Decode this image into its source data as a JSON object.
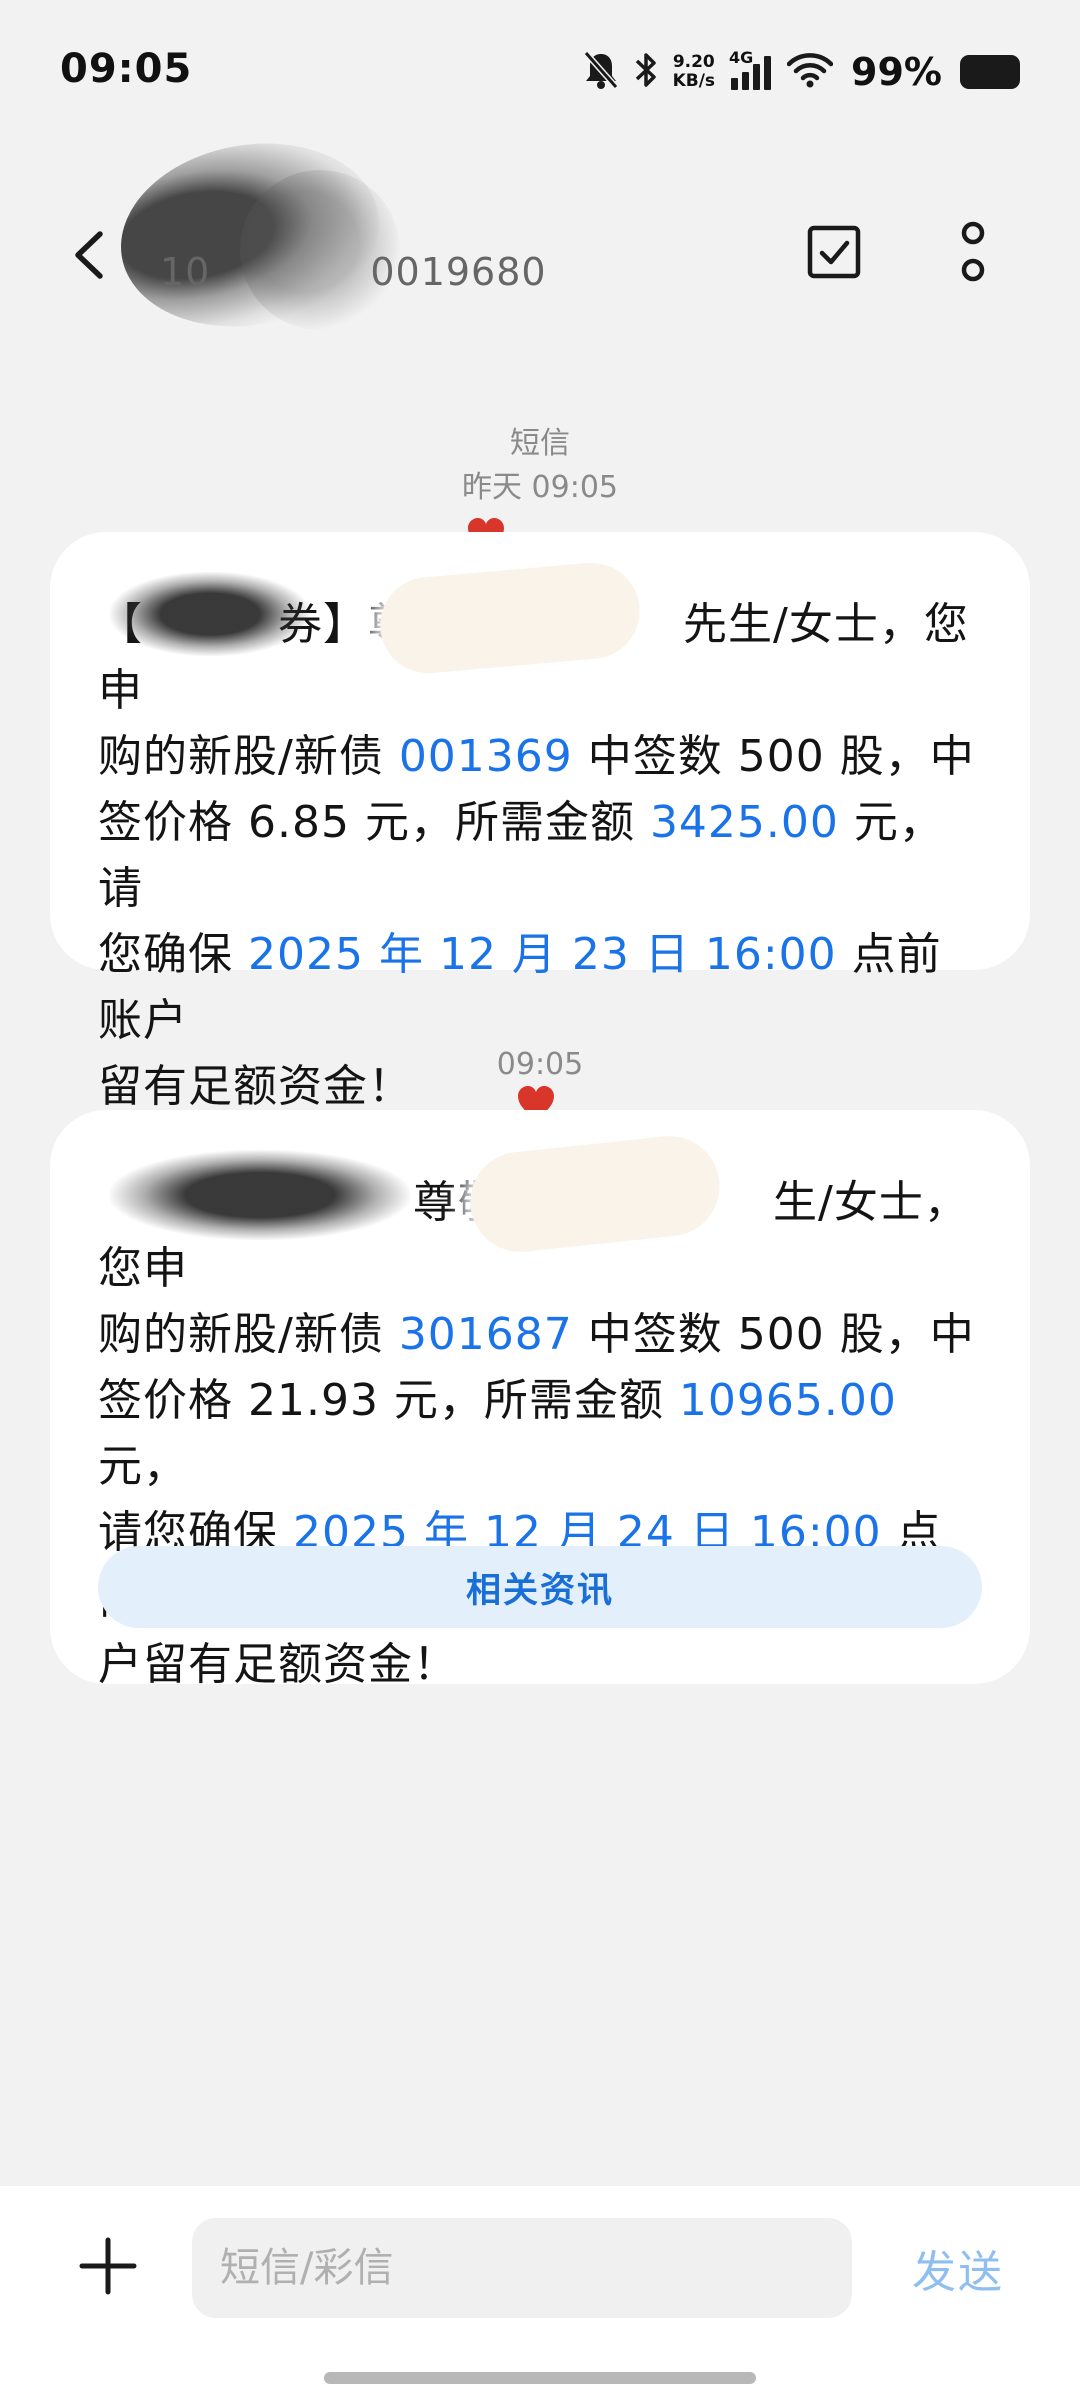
{
  "status_bar": {
    "time": "09:05",
    "net_speed_value": "9.20",
    "net_speed_unit": "KB/s",
    "network_type": "4G",
    "battery_percent": "99%",
    "icons": [
      "mute-icon",
      "bluetooth-icon",
      "signal-icon",
      "wifi-icon",
      "battery-icon"
    ]
  },
  "header": {
    "contact_number": "10        0019680",
    "back_icon": "chevron-left-icon",
    "select_icon": "checkbox-icon",
    "more_icon": "more-vertical-icon"
  },
  "messages": [
    {
      "timestamp_label": "短信",
      "timestamp": "昨天 09:05",
      "lines": [
        {
          "segments": [
            {
              "t": "【",
              "hl": false
            },
            {
              "t": "   券】尊",
              "hl": false
            },
            {
              "t": "      ",
              "hl": false
            },
            {
              "t": "先生/女士，您申",
              "hl": false
            }
          ]
        },
        {
          "segments": [
            {
              "t": "购的新股/新债 ",
              "hl": false
            },
            {
              "t": "001369",
              "hl": true
            },
            {
              "t": " 中签数 500 股，中",
              "hl": false
            }
          ]
        },
        {
          "segments": [
            {
              "t": "签价格 6.85 元，所需金额 ",
              "hl": false
            },
            {
              "t": "3425.00",
              "hl": true
            },
            {
              "t": " 元，请",
              "hl": false
            }
          ]
        },
        {
          "segments": [
            {
              "t": "您确保 ",
              "hl": false
            },
            {
              "t": "2025 年 12 月 23 日 16:00",
              "hl": true
            },
            {
              "t": " 点前账户",
              "hl": false
            }
          ]
        },
        {
          "segments": [
            {
              "t": "留有足额资金！",
              "hl": false
            }
          ]
        }
      ]
    },
    {
      "timestamp": "09:05",
      "lines": [
        {
          "segments": [
            {
              "t": "       尊敬",
              "hl": false
            },
            {
              "t": "      ",
              "hl": false
            },
            {
              "t": "生/女士，您申",
              "hl": false
            }
          ]
        },
        {
          "segments": [
            {
              "t": "购的新股/新债 ",
              "hl": false
            },
            {
              "t": "301687",
              "hl": true
            },
            {
              "t": " 中签数 500 股，中",
              "hl": false
            }
          ]
        },
        {
          "segments": [
            {
              "t": "签价格 21.93 元，所需金额 ",
              "hl": false
            },
            {
              "t": "10965.00",
              "hl": true
            },
            {
              "t": " 元，",
              "hl": false
            }
          ]
        },
        {
          "segments": [
            {
              "t": "请您确保 ",
              "hl": false
            },
            {
              "t": "2025 年 12 月 24 日 16:00",
              "hl": true
            },
            {
              "t": " 点前账",
              "hl": false
            }
          ]
        },
        {
          "segments": [
            {
              "t": "户留有足额资金！",
              "hl": false
            }
          ]
        }
      ],
      "action_button": "相关资讯"
    }
  ],
  "composer": {
    "placeholder": "短信/彩信",
    "send_label": "发送",
    "plus_icon": "plus-icon"
  },
  "colors": {
    "highlight": "#1a73e8",
    "send_disabled": "#8fbff0",
    "related_bg": "#e3f0fc",
    "heart": "#d9362b"
  }
}
